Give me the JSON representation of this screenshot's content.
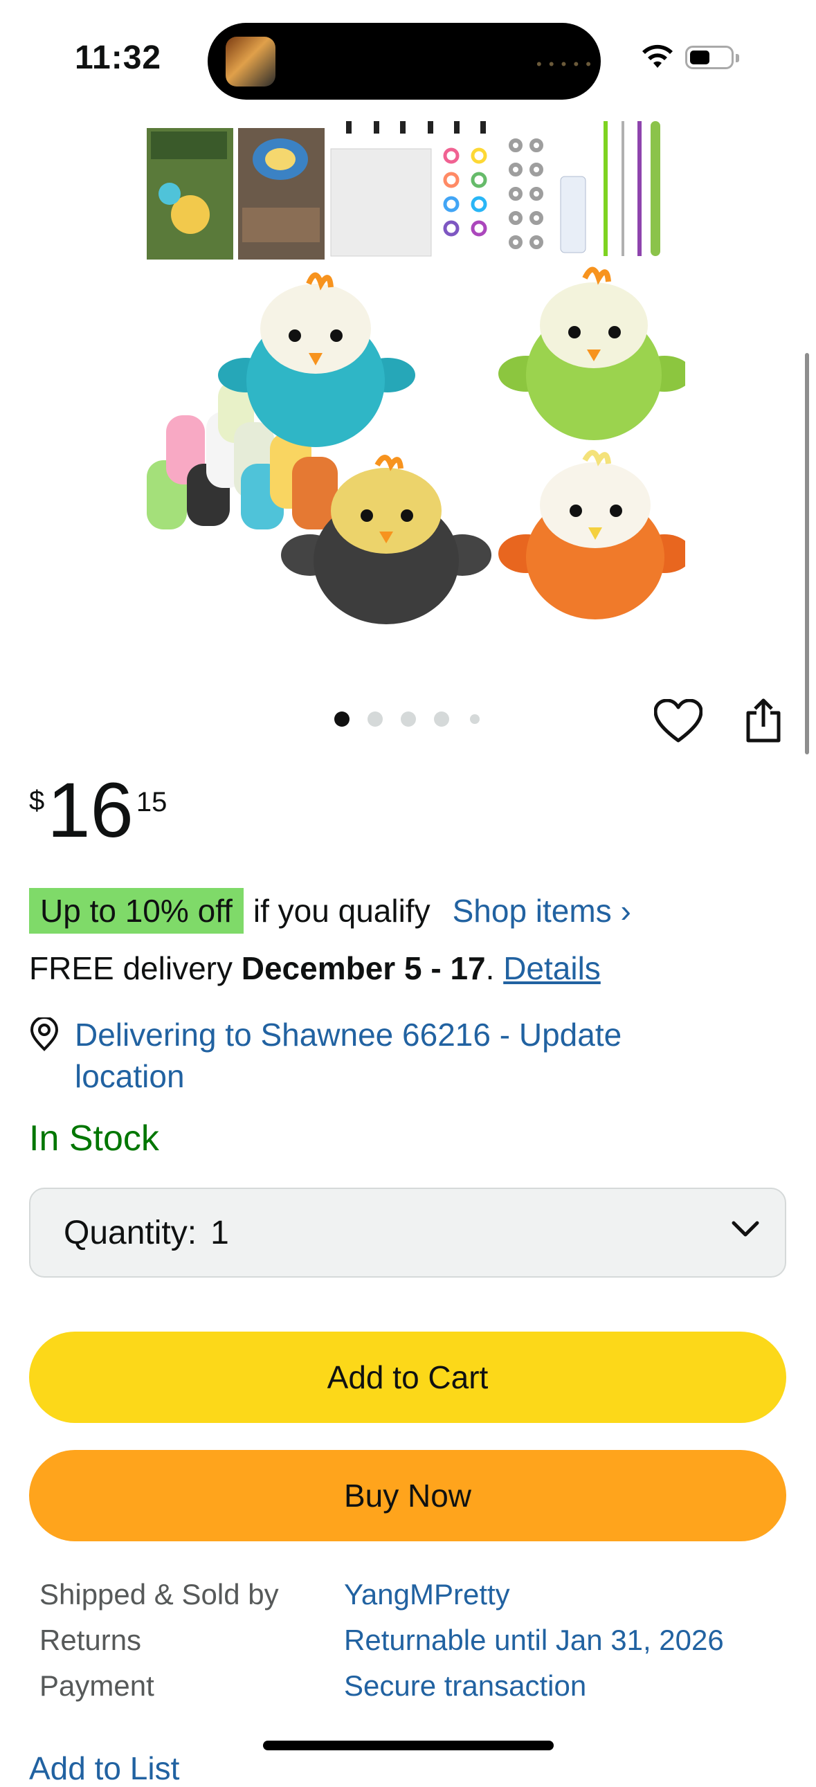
{
  "status_bar": {
    "time": "11:32"
  },
  "product": {
    "image_alt": "Bird crochet kit product image",
    "carousel": {
      "total": 5,
      "active": 1
    }
  },
  "price": {
    "symbol": "$",
    "whole": "16",
    "fraction": "15"
  },
  "discount": {
    "badge": "Up to 10% off",
    "qualify": "if you qualify",
    "shop_link": "Shop items ›"
  },
  "delivery": {
    "prefix": "FREE delivery ",
    "dates": "December 5 - 17",
    "sep": ". ",
    "details_link": "Details"
  },
  "location": {
    "text": "Delivering to Shawnee 66216 - Update location"
  },
  "stock": {
    "status": "In Stock"
  },
  "quantity": {
    "label": "Quantity:",
    "value": "1"
  },
  "buttons": {
    "add_to_cart": "Add to Cart",
    "buy_now": "Buy Now"
  },
  "info": [
    {
      "label": "Shipped & Sold by",
      "value": "YangMPretty"
    },
    {
      "label": "Returns",
      "value": "Returnable until Jan 31, 2026"
    },
    {
      "label": "Payment",
      "value": "Secure transaction"
    }
  ],
  "add_to_list": "Add to List",
  "colors": {
    "accent_link": "#2162a1",
    "add_to_cart": "#fcd819",
    "buy_now": "#ffa41c",
    "discount_badge": "#7fda69",
    "in_stock": "#007600"
  }
}
